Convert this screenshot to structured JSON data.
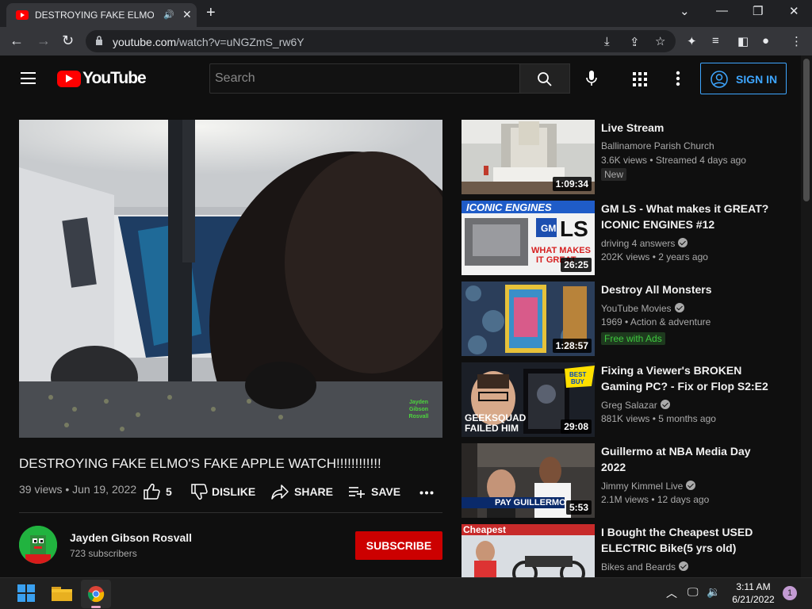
{
  "browser": {
    "tab_title": "DESTROYING FAKE ELMO'S FAKE APPLE WATCH!!!!!!!!!!!!",
    "url_domain": "youtube.com",
    "url_path": "/watch?v=uNGZmS_rw6Y"
  },
  "header": {
    "logo_text": "YouTube",
    "search_placeholder": "Search",
    "sign_in_label": "SIGN IN"
  },
  "video": {
    "title": "DESTROYING FAKE ELMO'S FAKE APPLE WATCH!!!!!!!!!!!!",
    "meta": "39 views • Jun 19, 2022",
    "likes": "5",
    "dislike_label": "DISLIKE",
    "share_label": "SHARE",
    "save_label": "SAVE",
    "watermark": "Jayden Gibson Rosvall",
    "channel_name": "Jayden Gibson Rosvall",
    "subscribers": "723 subscribers",
    "subscribe_label": "SUBSCRIBE"
  },
  "recommendations": [
    {
      "title": "Live Stream",
      "channel": "Ballinamore Parish Church",
      "meta": "3.6K views • Streamed 4 days ago",
      "badge": "New",
      "duration": "1:09:34"
    },
    {
      "title": "GM LS - What makes it GREAT? ICONIC ENGINES #12",
      "channel": "driving 4 answers",
      "meta": "202K views • 2 years ago",
      "duration": "26:25",
      "thumb_text": "ICONIC ENGINES"
    },
    {
      "title": "Destroy All Monsters",
      "channel": "YouTube Movies",
      "meta": "1969 • Action & adventure",
      "badge": "Free with Ads",
      "duration": "1:28:57"
    },
    {
      "title": "Fixing a Viewer's BROKEN Gaming PC? - Fix or Flop S2:E2",
      "channel": "Greg Salazar",
      "meta": "881K views • 5 months ago",
      "duration": "29:08",
      "thumb_text": "GEEKSQUAD FAILED HIM"
    },
    {
      "title": "Guillermo at NBA Media Day 2022",
      "channel": "Jimmy Kimmel Live",
      "meta": "2.1M views • 12 days ago",
      "duration": "5:53",
      "thumb_text": "PAY GUILLERMO $"
    },
    {
      "title": "I Bought the Cheapest USED ELECTRIC Bike(5 yrs old)",
      "channel": "Bikes and Beards",
      "thumb_text": "Cheapest"
    }
  ],
  "taskbar": {
    "time": "3:11 AM",
    "date": "6/21/2022",
    "notification_count": "1"
  }
}
